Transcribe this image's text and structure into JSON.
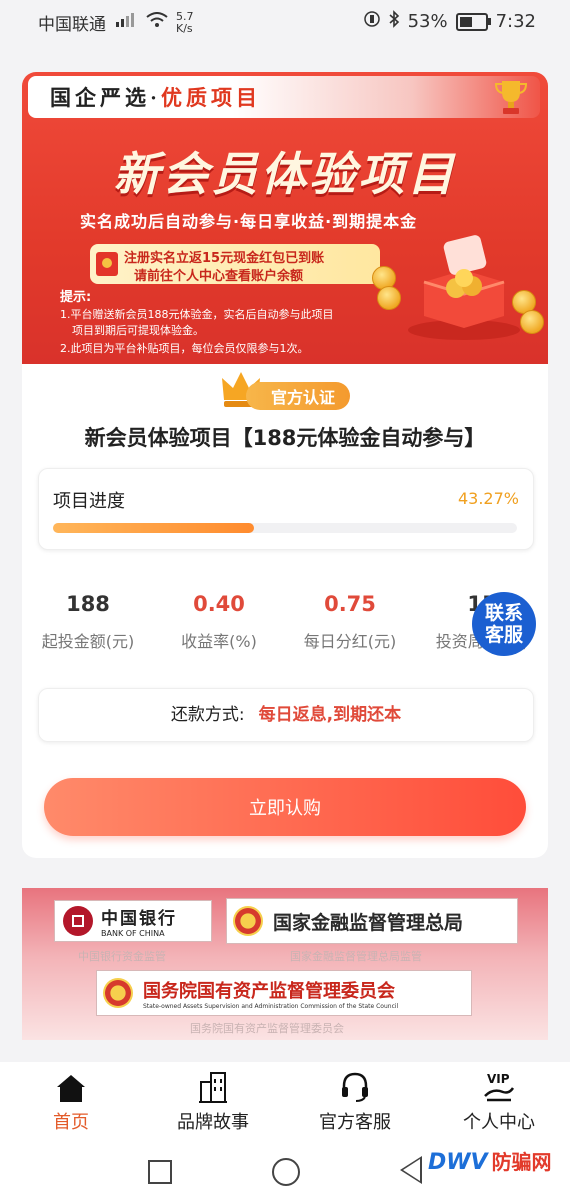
{
  "status_bar": {
    "carrier": "中国联通",
    "net_speed": "5.7\nK/s",
    "battery": "53%",
    "time": "7:32"
  },
  "banner": {
    "header_left": "国企严选·",
    "header_right": "优质项目",
    "title": "新会员体验项目",
    "subtitle": "实名成功后自动参与·每日享收益·到期提本金",
    "redpacket_line1": "注册实名立返15元现金红包已到账",
    "redpacket_line2": "请前往个人中心查看账户余额",
    "tips_title": "提示:",
    "tip1_line1": "1.平台赠送新会员188元体验金，实名后自动参与此项目",
    "tip1_line2": "项目到期后可提现体验金。",
    "tip2": "2.此项目为平台补贴项目，每位会员仅限参与1次。"
  },
  "badge": "官方认证",
  "project_title": "新会员体验项目【188元体验金自动参与】",
  "progress": {
    "label": "项目进度",
    "percent_text": "43.27%",
    "fraction": 0.4327
  },
  "stats": [
    {
      "value": "188",
      "label": "起投金额(元)"
    },
    {
      "value": "0.40",
      "label": "收益率(%)"
    },
    {
      "value": "0.75",
      "label": "每日分红(元)"
    },
    {
      "value": "15",
      "label": "投资周期(天)"
    }
  ],
  "repayment": {
    "key": "还款方式:",
    "value": "每日返息,到期还本"
  },
  "buy_button": "立即认购",
  "customer_service_float": "联系\n客服",
  "regulators": {
    "boc_cn": "中国银行",
    "boc_en": "BANK OF CHINA",
    "boc_caption": "中国银行资金监管",
    "nfra_name": "国家金融监督管理总局",
    "nfra_caption": "国家金融监督管理总局监管",
    "sasac_name": "国务院国有资产监督管理委员会",
    "sasac_en": "State-owned Assets Supervision and Administration Commission of the State Council",
    "sasac_caption": "国务院国有资产监督管理委员会"
  },
  "tabs": [
    {
      "label": "首页",
      "icon": "home-icon"
    },
    {
      "label": "品牌故事",
      "icon": "building-icon"
    },
    {
      "label": "官方客服",
      "icon": "headset-icon"
    },
    {
      "label": "个人中心",
      "icon": "vip-icon"
    }
  ],
  "watermark": {
    "brand": "DWV",
    "text": "防骗网"
  },
  "colors": {
    "accent_red": "#e04a3a",
    "progress_orange": "#f0a020",
    "cs_blue": "#1b5fd1",
    "active_tab": "#e35b2a"
  }
}
